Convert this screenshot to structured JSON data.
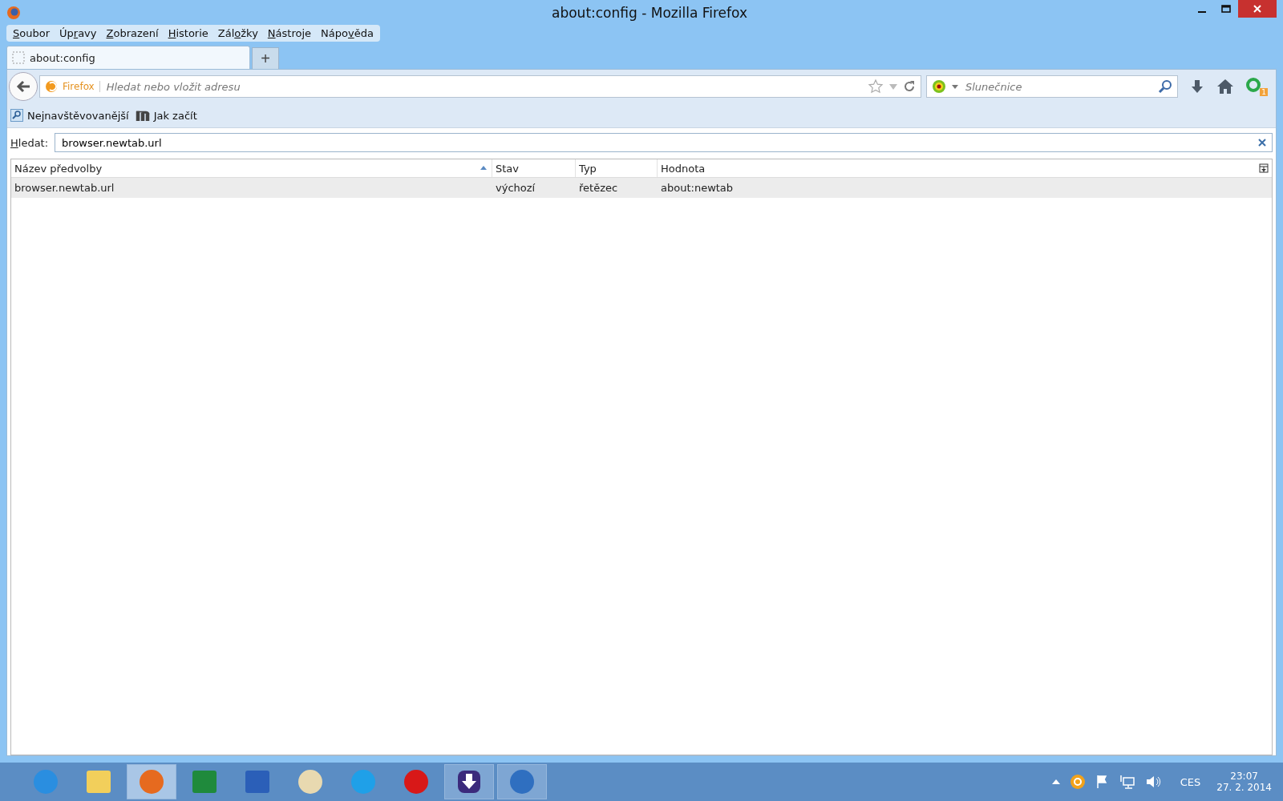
{
  "window": {
    "title": "about:config - Mozilla Firefox"
  },
  "menu": [
    {
      "key": "S",
      "after": "oubor"
    },
    {
      "before": "Úp",
      "key": "r",
      "after": "avy"
    },
    {
      "key": "Z",
      "after": "obrazení"
    },
    {
      "key": "H",
      "after": "istorie"
    },
    {
      "before": "Zál",
      "key": "o",
      "after": "žky"
    },
    {
      "key": "N",
      "after": "ástroje"
    },
    {
      "before": "Nápo",
      "key": "v",
      "after": "ěda"
    }
  ],
  "tabs": [
    {
      "label": "about:config",
      "selected": true
    }
  ],
  "new_tab": "+",
  "address": {
    "identity": "Firefox",
    "placeholder": "Hledat nebo vložit adresu"
  },
  "search": {
    "placeholder": "Slunečnice"
  },
  "addon_badge": "1",
  "bookmarks": [
    {
      "label": "Nejnavštěvovanější",
      "kind": "search"
    },
    {
      "label": "Jak začít",
      "kind": "m"
    }
  ],
  "filter": {
    "label_key": "H",
    "label_rest": "ledat:",
    "value": "browser.newtab.url"
  },
  "table": {
    "columns": [
      {
        "label": "Název předvolby",
        "sorted": true
      },
      {
        "label": "Stav",
        "sorted": false
      },
      {
        "label": "Typ",
        "sorted": false
      },
      {
        "label": "Hodnota",
        "sorted": false
      }
    ],
    "rows": [
      {
        "cells": [
          "browser.newtab.url",
          "výchozí",
          "řetězec",
          "about:newtab"
        ],
        "selected": true
      }
    ]
  },
  "taskbar": {
    "apps": [
      {
        "kind": "ie",
        "active": false,
        "running": false
      },
      {
        "kind": "folder",
        "active": false,
        "running": false
      },
      {
        "kind": "firefox",
        "active": true,
        "running": true
      },
      {
        "kind": "excel",
        "active": false,
        "running": false
      },
      {
        "kind": "word",
        "active": false,
        "running": false
      },
      {
        "kind": "paint",
        "active": false,
        "running": false
      },
      {
        "kind": "skype",
        "active": false,
        "running": false
      },
      {
        "kind": "opera",
        "active": false,
        "running": false
      },
      {
        "kind": "download",
        "active": false,
        "running": true
      },
      {
        "kind": "thunderbird",
        "active": false,
        "running": true
      }
    ],
    "language": "CES",
    "time": "23:07",
    "date": "27. 2. 2014"
  }
}
